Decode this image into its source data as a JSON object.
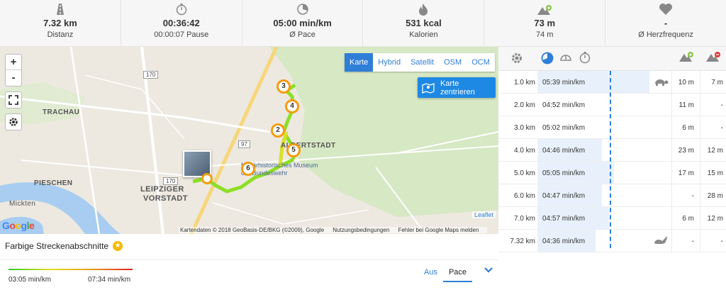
{
  "stats": [
    {
      "icon": "road-icon",
      "value": "7.32 km",
      "label": "Distanz"
    },
    {
      "icon": "stopwatch-icon",
      "value": "00:36:42",
      "label": "00:00:07 Pause"
    },
    {
      "icon": "pace-gauge-icon",
      "value": "05:00 min/km",
      "label": "Ø Pace"
    },
    {
      "icon": "flame-icon",
      "value": "531 kcal",
      "label": "Kalorien"
    },
    {
      "icon": "elevation-up-icon",
      "value": "73 m",
      "label": "74 m"
    },
    {
      "icon": "heart-icon",
      "value": "-",
      "label": "Ø Herzfrequenz"
    }
  ],
  "map": {
    "layers": [
      "Karte",
      "Hybrid",
      "Satellit",
      "OSM",
      "OCM"
    ],
    "active_layer": "Karte",
    "center_button": "Karte zentrieren",
    "zoom_in": "+",
    "zoom_out": "-",
    "leaflet": "Leaflet",
    "attribution": [
      "Kartendaten © 2018 GeoBasis-DE/BKG (©2009), Google",
      "Nutzungsbedingungen",
      "Fehler bei Google Maps melden"
    ],
    "labels": {
      "trachau": "TRACHAU",
      "pieschen": "PIESCHEN",
      "leipziger": "LEIPZIGER",
      "vorstadt": "VORSTADT",
      "albertstadt": "ALBERTSTADT",
      "mickten": "Mickten",
      "museum": "Militärhistorisches Museum der Bundeswehr",
      "road_170a": "170",
      "road_170b": "170",
      "road_97": "97"
    },
    "markers": [
      "2",
      "3",
      "4",
      "5",
      "6"
    ],
    "google": [
      "G",
      "o",
      "o",
      "g",
      "l",
      "e"
    ]
  },
  "segments": {
    "title": "Farbige Streckenabschnitte",
    "star": "★",
    "min": "03:05 min/km",
    "max": "07:34 min/km",
    "toggle_off": "Aus",
    "toggle_on": "Pace"
  },
  "table": {
    "rows": [
      {
        "km": "1.0 km",
        "pace": "05:39 min/km",
        "fraction": 0.83,
        "up": "10 m",
        "down": "7 m",
        "animal": "turtle"
      },
      {
        "km": "2.0 km",
        "pace": "04:52 min/km",
        "fraction": 0.0,
        "up": "11 m",
        "down": "-",
        "animal": ""
      },
      {
        "km": "3.0 km",
        "pace": "05:02 min/km",
        "fraction": 0.0,
        "up": "6 m",
        "down": "-",
        "animal": ""
      },
      {
        "km": "4.0 km",
        "pace": "04:46 min/km",
        "fraction": 0.48,
        "up": "23 m",
        "down": "12 m",
        "animal": ""
      },
      {
        "km": "5.0 km",
        "pace": "05:05 min/km",
        "fraction": 0.57,
        "up": "17 m",
        "down": "15 m",
        "animal": ""
      },
      {
        "km": "6.0 km",
        "pace": "04:47 min/km",
        "fraction": 0.48,
        "up": "-",
        "down": "28 m",
        "animal": ""
      },
      {
        "km": "7.0 km",
        "pace": "04:57 min/km",
        "fraction": 0.53,
        "up": "6 m",
        "down": "12 m",
        "animal": ""
      },
      {
        "km": "7.32 km",
        "pace": "04:36 min/km",
        "fraction": 0.43,
        "up": "-",
        "down": "-",
        "animal": "rabbit"
      }
    ]
  },
  "colors": {
    "accent": "#2f7ed8",
    "route_fast": "#7bdc2a",
    "route_slow": "#e6e02a",
    "marker": "#f39c12"
  }
}
